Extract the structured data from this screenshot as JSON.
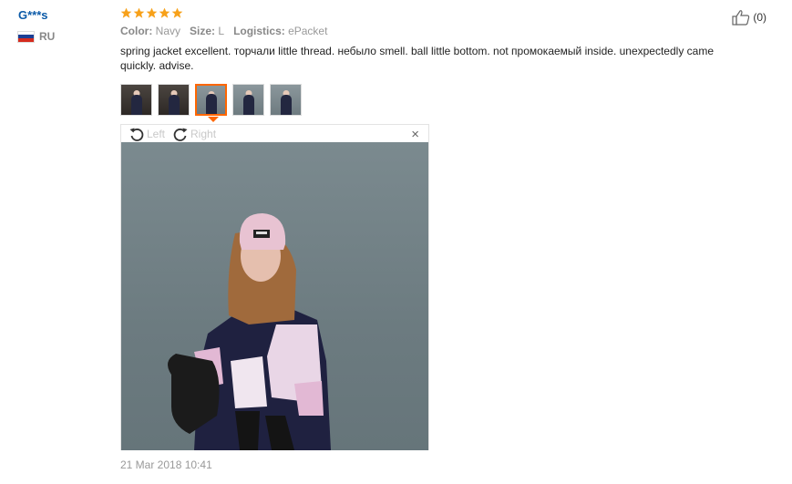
{
  "reviewer": {
    "name": "G***s",
    "country": "RU"
  },
  "rating": {
    "stars": 5,
    "max": 5,
    "color": "#f7a11a"
  },
  "attributes": [
    {
      "key": "Color:",
      "value": "Navy"
    },
    {
      "key": "Size:",
      "value": "L"
    },
    {
      "key": "Logistics:",
      "value": "ePacket"
    }
  ],
  "feedback": "spring jacket excellent. торчали little thread. небыло smell. ball little bottom. not промокаемый inside. unexpectedly came quickly. advise.",
  "thumbnails": {
    "count": 5,
    "active_index": 2
  },
  "viewer": {
    "rotate_left": "Left",
    "rotate_right": "Right",
    "close": "×"
  },
  "date": "21 Mar 2018 10:41",
  "helpful": {
    "count": "(0)"
  },
  "colors": {
    "accent": "#ff6600",
    "username": "#0b5aa8"
  }
}
